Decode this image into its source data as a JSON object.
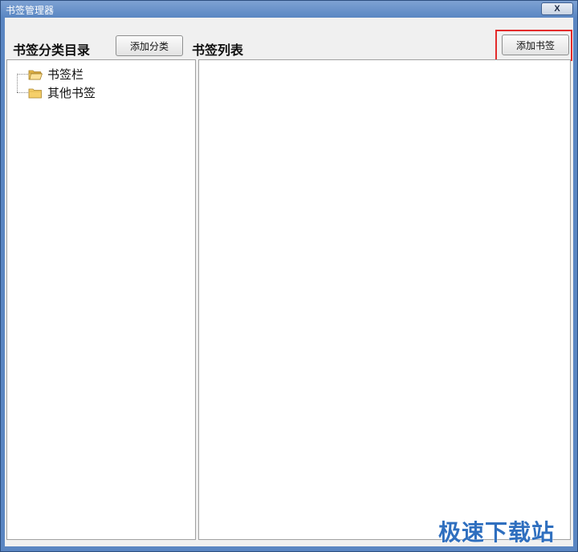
{
  "window": {
    "title": "书签管理器",
    "close_label": "X"
  },
  "left_panel": {
    "heading": "书签分类目录",
    "add_button_label": "添加分类",
    "tree": [
      {
        "label": "书签栏",
        "icon": "folder-open-icon"
      },
      {
        "label": "其他书签",
        "icon": "folder-icon"
      }
    ]
  },
  "right_panel": {
    "heading": "书签列表",
    "add_button_label": "添加书签",
    "items": []
  },
  "watermark": "极速下载站",
  "colors": {
    "titlebar": "#5b87c3",
    "highlight_box": "#e32b2b",
    "folder": "#f5cf6a",
    "watermark": "#2f6fbf"
  }
}
